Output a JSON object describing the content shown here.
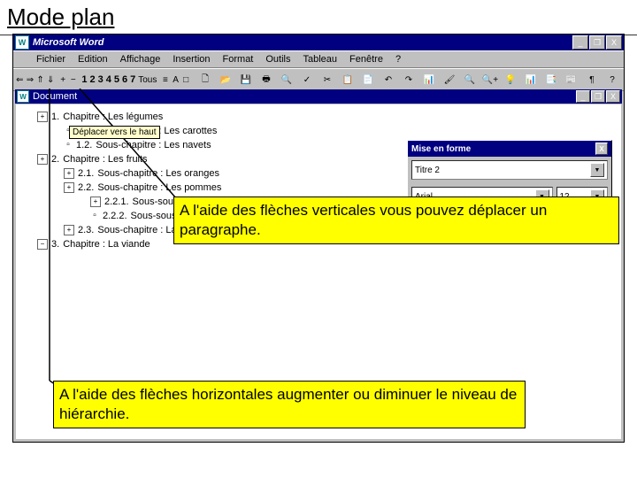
{
  "slide_title": "Mode plan",
  "titlebar": {
    "app": "Microsoft Word"
  },
  "win_buttons": {
    "min": "_",
    "restore": "❐",
    "close": "X"
  },
  "doc_win_buttons": {
    "min": "_",
    "restore": "❐",
    "close": "X"
  },
  "menu": {
    "file": "Fichier",
    "edit": "Edition",
    "view": "Affichage",
    "insert": "Insertion",
    "format": "Format",
    "tools": "Outils",
    "table": "Tableau",
    "window": "Fenêtre",
    "help": "?"
  },
  "tooltip": "Déplacer vers le haut",
  "outline_toolbar": {
    "promote": "⇐",
    "demote": "⇒",
    "move_up": "⇑",
    "move_down": "⇓",
    "expand": "+",
    "collapse": "−",
    "levels": [
      "1",
      "2",
      "3",
      "4",
      "5",
      "6",
      "7"
    ],
    "all": "Tous",
    "group1": "≡",
    "group2": "A",
    "group3": "□"
  },
  "std_toolbar_icons": [
    "🗋",
    "📂",
    "💾",
    "🖶",
    "🔍",
    "✓",
    "✂",
    "📋",
    "📄",
    "↶",
    "↷",
    "📊",
    "🖌",
    "🔍",
    "🔍+",
    "💡",
    "📊",
    "📑",
    "📰",
    "¶",
    "?"
  ],
  "doc": {
    "title": "Document"
  },
  "outline": [
    {
      "indent": 0,
      "icon": "plus",
      "num": "1.",
      "text": "Chapitre : Les légumes"
    },
    {
      "indent": 1,
      "icon": "body",
      "num": "1.1.",
      "text": "Sous-chapitre : Les carottes"
    },
    {
      "indent": 1,
      "icon": "body",
      "num": "1.2.",
      "text": "Sous-chapitre : Les navets"
    },
    {
      "indent": 0,
      "icon": "plus",
      "num": "2.",
      "text": "Chapitre : Les fruits"
    },
    {
      "indent": 1,
      "icon": "plus",
      "num": "2.1.",
      "text": "Sous-chapitre : Les oranges"
    },
    {
      "indent": 1,
      "icon": "plus",
      "num": "2.2.",
      "text": "Sous-chapitre : Les pommes"
    },
    {
      "indent": 2,
      "icon": "plus",
      "num": "2.2.1.",
      "text": "Sous-sous-chapitre : Les pommes rouges"
    },
    {
      "indent": 2,
      "icon": "body",
      "num": "2.2.2.",
      "text": "Sous-sous-chapitre : Les pommes vertes"
    },
    {
      "indent": 1,
      "icon": "plus",
      "num": "2.3.",
      "text": "Sous-chapitre : La salade"
    },
    {
      "indent": 0,
      "icon": "minus",
      "num": "3.",
      "text": "Chapitre : La viande"
    }
  ],
  "format_panel": {
    "title": "Mise en forme",
    "close": "X",
    "style": "Titre 2",
    "font": "Arial",
    "size": "12",
    "dropdown_arrow": "▼"
  },
  "callouts": {
    "vertical": "A l'aide des flèches verticales vous pouvez déplacer un paragraphe.",
    "horizontal": "A l'aide des flèches horizontales augmenter ou diminuer le niveau de hiérarchie."
  }
}
